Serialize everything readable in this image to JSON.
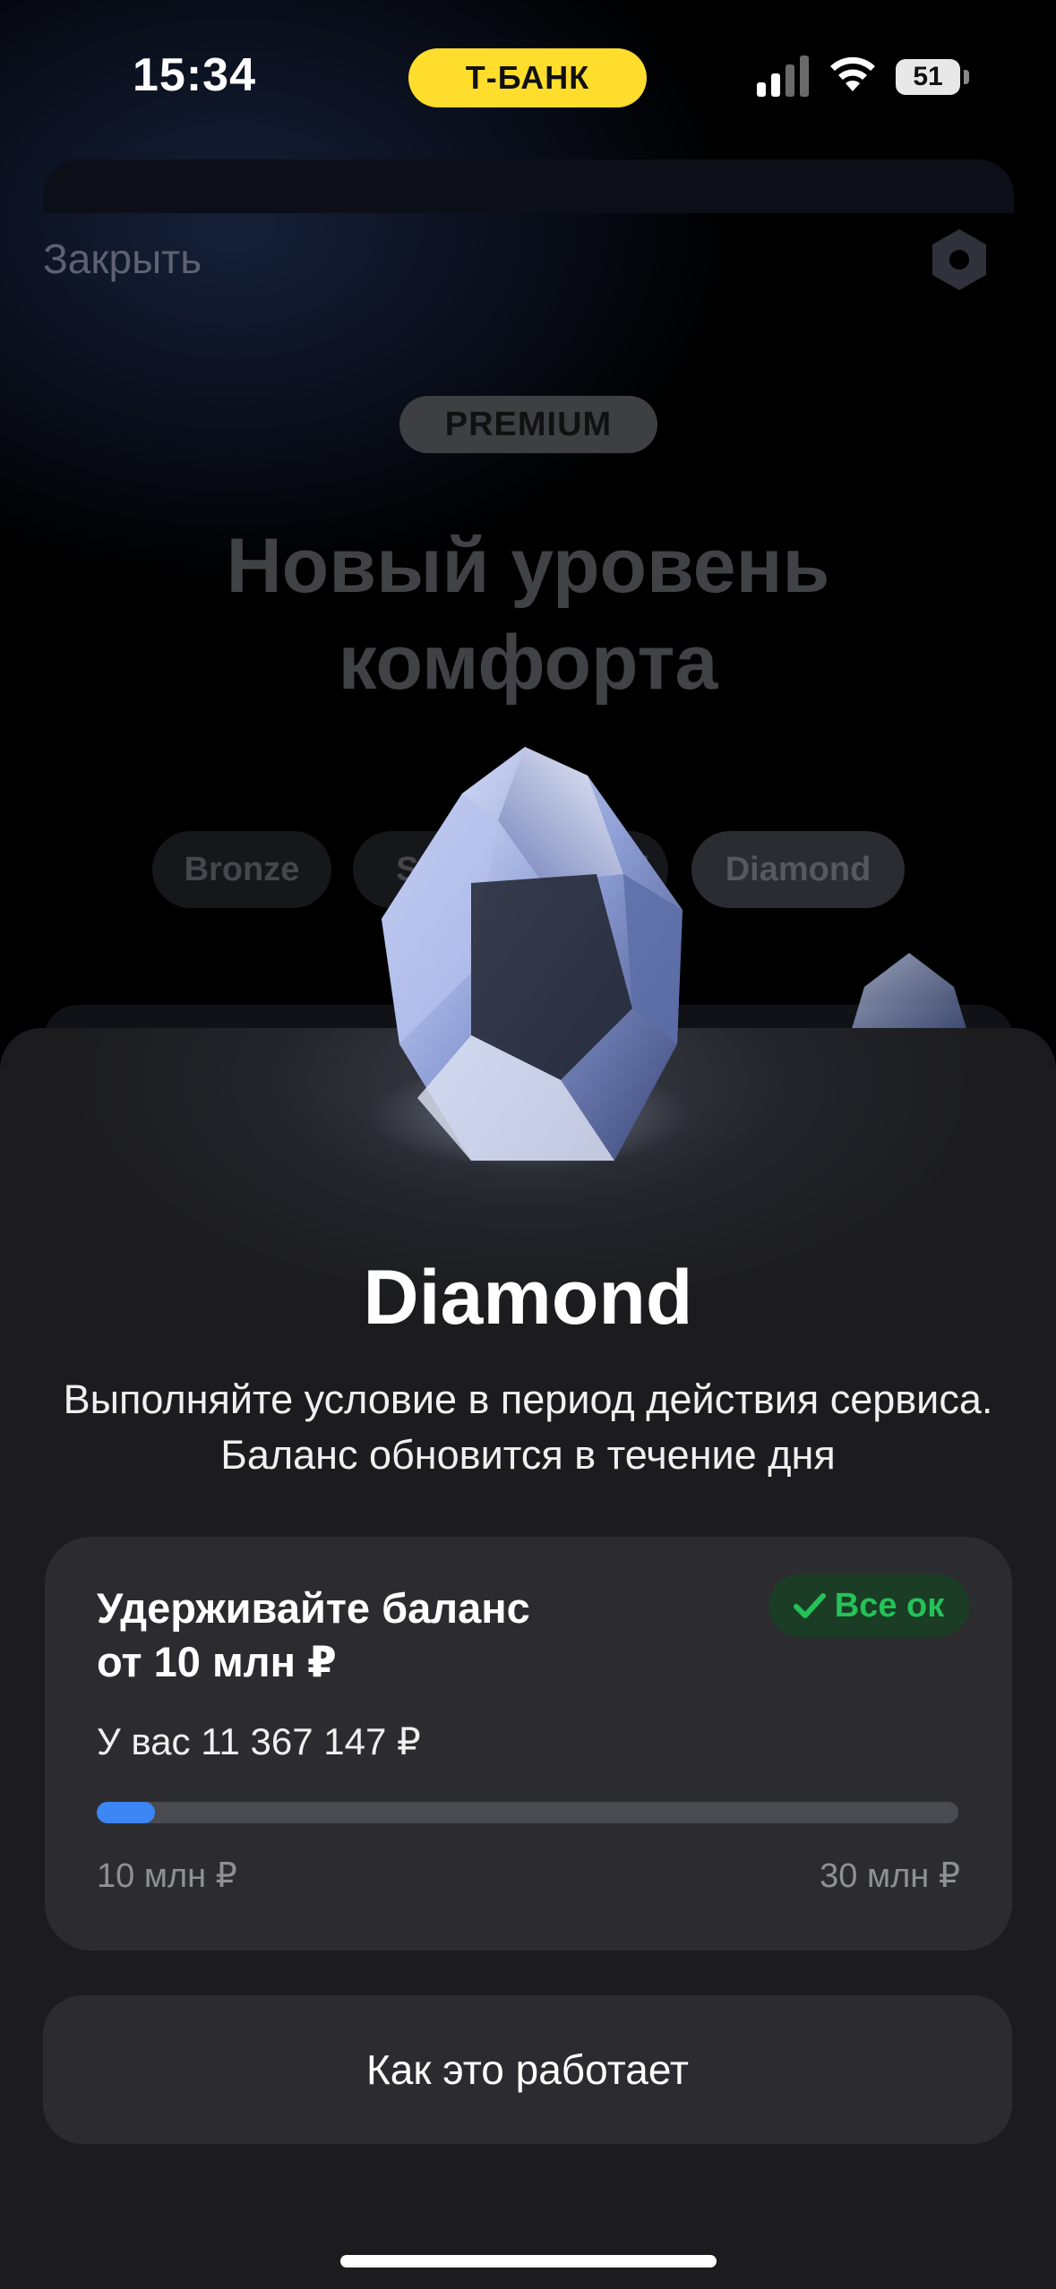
{
  "status_bar": {
    "time": "15:34",
    "carrier_badge": "Т-БАНК",
    "battery": "51",
    "icons": [
      "signal-icon",
      "wifi-icon",
      "battery-icon"
    ]
  },
  "background_screen": {
    "close_label": "Закрыть",
    "settings_icon": "hexagon-icon",
    "badge": "PREMIUM",
    "title_line1": "Новый уровень",
    "title_line2": "комфорта",
    "tabs": [
      {
        "label": "Bronze"
      },
      {
        "label": "Silver"
      },
      {
        "label": "Gold"
      },
      {
        "label": "Diamond",
        "active": true
      }
    ]
  },
  "sheet": {
    "title": "Diamond",
    "description": "Выполняйте условие в период действия сервиса. Баланс обновится в течение дня",
    "condition": {
      "title_line1": "Удерживайте баланс",
      "title_line2": "от 10 млн ₽",
      "status": "Все ок",
      "balance_text": "У вас 11 367 147 ₽",
      "progress_fraction": 0.068,
      "range_min": "10 млн ₽",
      "range_max": "30 млн ₽"
    },
    "how_it_works_label": "Как это работает"
  },
  "colors": {
    "accent_yellow": "#ffdd2d",
    "progress_blue": "#3d86f5",
    "ok_green": "#25c159",
    "sheet_bg": "#1c1c1f",
    "card_bg": "#2c2c30"
  }
}
